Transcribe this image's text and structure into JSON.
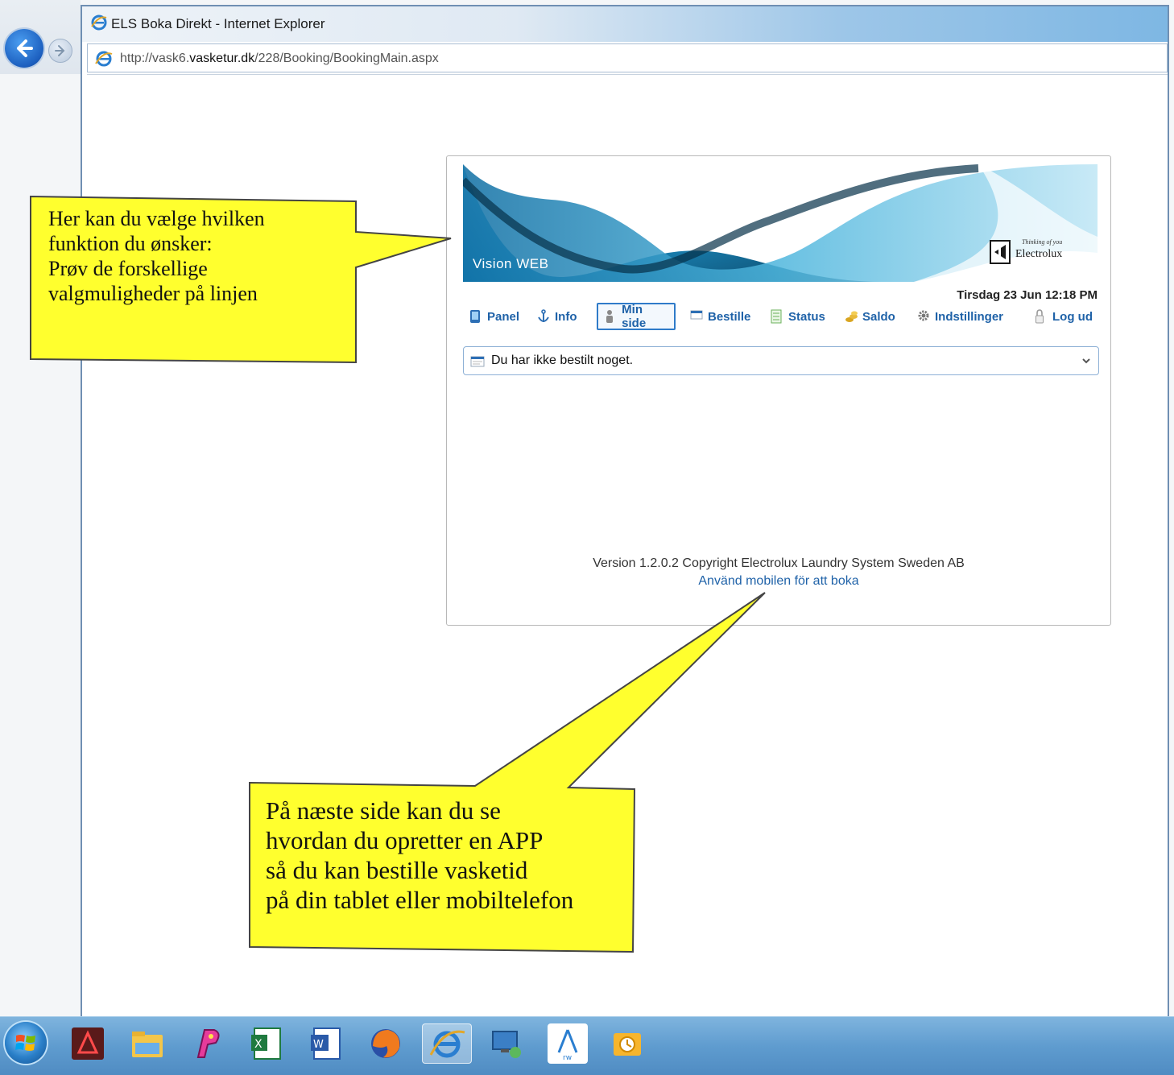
{
  "browser": {
    "window_title": "ELS Boka Direkt - Internet Explorer",
    "url_prefix": "http://vask6.",
    "url_host": "vasketur.dk",
    "url_path": "/228/Booking/BookingMain.aspx"
  },
  "banner": {
    "product_title": "Vision WEB",
    "brand_tagline": "Thinking of you",
    "brand_name": "Electrolux"
  },
  "datetime": "Tirsdag 23 Jun 12:18 PM",
  "nav": {
    "items": [
      {
        "label": "Panel",
        "icon": "tablet-icon"
      },
      {
        "label": "Info",
        "icon": "anchor-icon"
      },
      {
        "label": "Min side",
        "icon": "person-icon",
        "active": true
      },
      {
        "label": "Bestille",
        "icon": "window-icon"
      },
      {
        "label": "Status",
        "icon": "list-icon"
      },
      {
        "label": "Saldo",
        "icon": "coins-icon"
      },
      {
        "label": "Indstillinger",
        "icon": "gear-icon"
      },
      {
        "label": "Log ud",
        "icon": "lock-icon"
      }
    ]
  },
  "booking_select": {
    "selected": "Du har ikke bestilt noget."
  },
  "footer": {
    "version": "Version 1.2.0.2 Copyright Electrolux Laundry System Sweden AB",
    "mobile_link": "Använd mobilen för att boka"
  },
  "callouts": {
    "top": "Her kan du vælge hvilken\nfunktion du ønsker:\nPrøv de forskellige\nvalgmuligheder på linjen",
    "bottom": "På næste side kan du se\nhvordan du opretter en APP\nså du kan bestille vasketid\npå din tablet eller mobiltelefon"
  },
  "colors": {
    "callout_fill": "#ffff2e",
    "link_blue": "#1f62a8",
    "taskbar": "#5f9ccf"
  },
  "taskbar": {
    "apps": [
      "acrobat-icon",
      "file-explorer-icon",
      "paint-icon",
      "excel-icon",
      "word-icon",
      "firefox-icon",
      "internet-explorer-icon",
      "remote-desktop-icon",
      "app-rw-icon",
      "outlook-icon"
    ]
  }
}
